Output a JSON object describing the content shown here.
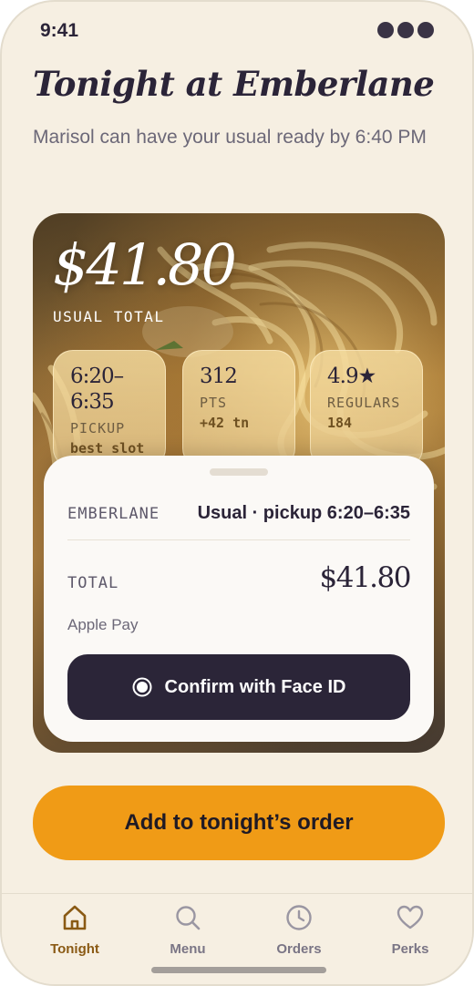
{
  "status_bar": {
    "time": "9:41"
  },
  "header": {
    "title": "Tonight at Emberlane",
    "subtitle": "Marisol can have your usual ready by 6:40 PM"
  },
  "hero": {
    "amount": "$41.80",
    "caption": "USUAL TOTAL",
    "stats": [
      {
        "value": "6:20–6:35",
        "label": "PICKUP",
        "sub": "best slot"
      },
      {
        "value": "312",
        "label": "PTS",
        "sub": "+42 tn"
      },
      {
        "value": "4.9★",
        "label": "REGULARS",
        "sub": "184"
      }
    ]
  },
  "payment_sheet": {
    "merchant": "EMBERLANE",
    "description": "Usual · pickup 6:20–6:35",
    "total_label": "TOTAL",
    "total_value": "$41.80",
    "method": "Apple Pay",
    "confirm_label": "Confirm with Face ID"
  },
  "cta": {
    "label": "Add to tonight’s order"
  },
  "tabs": [
    {
      "label": "Tonight",
      "icon": "home-icon",
      "active": true
    },
    {
      "label": "Menu",
      "icon": "search-icon",
      "active": false
    },
    {
      "label": "Orders",
      "icon": "clock-icon",
      "active": false
    },
    {
      "label": "Perks",
      "icon": "heart-icon",
      "active": false
    }
  ],
  "colors": {
    "background": "#f6efe2",
    "accent": "#f09b16",
    "ink": "#2b2438",
    "active_tab": "#8a5a14"
  }
}
